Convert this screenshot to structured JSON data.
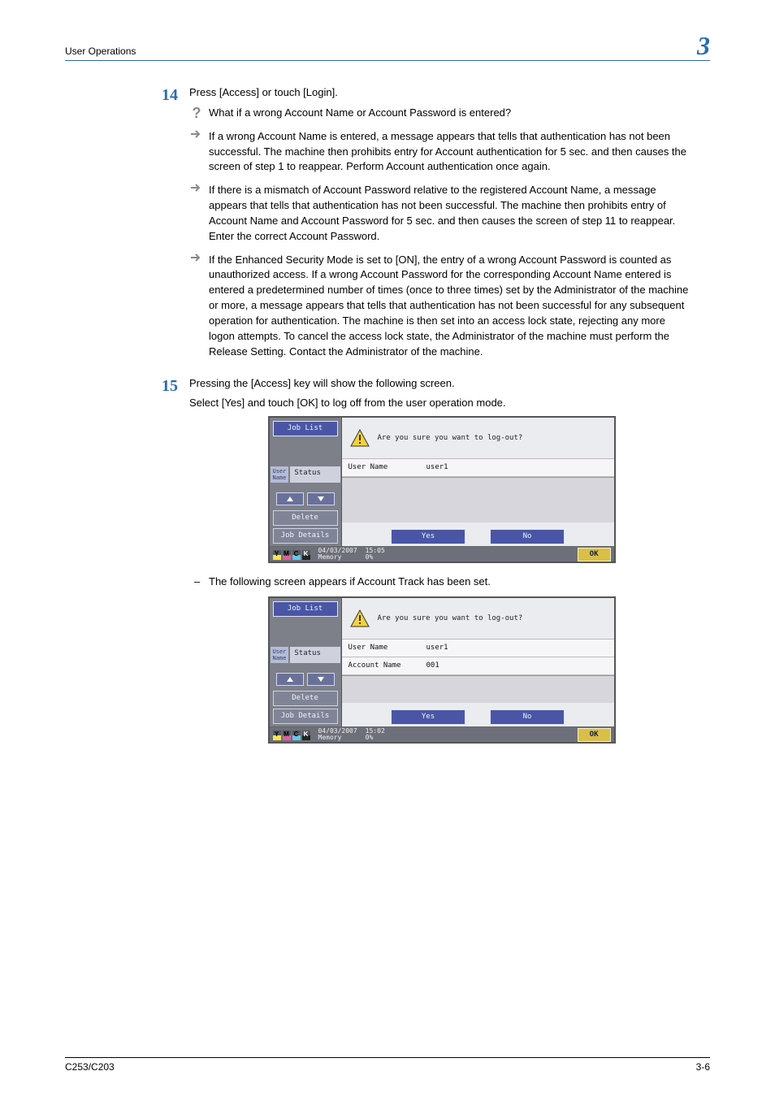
{
  "header": {
    "section_title": "User Operations",
    "chapter_number": "3"
  },
  "steps": {
    "s14": {
      "number": "14",
      "main": "Press [Access] or touch [Login].",
      "question": "What if a wrong Account Name or Account Password is entered?",
      "bullets": [
        "If a wrong Account Name is entered, a message appears that tells that authentication has not been successful. The machine then prohibits entry for Account authentication for 5 sec. and then causes the screen of step 1 to reappear. Perform Account authentication once again.",
        "If there is a mismatch of Account Password relative to the registered Account Name, a message appears that tells that authentication has not been successful. The machine then prohibits entry of Account Name and Account Password for 5 sec. and then causes the screen of step 11 to reappear. Enter the correct Account Password.",
        "If the Enhanced Security Mode is set to [ON], the entry of a wrong Account Password is counted as unauthorized access. If a wrong Account Password for the corresponding Account Name entered is entered a predetermined number of times (once to three times) set by the Administrator of the machine or more, a message appears that tells that authentication has not been successful for any subsequent operation for authentication. The machine is then set into an access lock state, rejecting any more logon attempts. To cancel the access lock state, the Administrator of the machine must perform the Release Setting. Contact the Administrator of the machine."
      ]
    },
    "s15": {
      "number": "15",
      "line1": "Pressing the [Access] key will show the following screen.",
      "line2": "Select [Yes] and touch [OK] to log off from the user operation mode.",
      "dash_note": "The following screen appears if Account Track has been set."
    }
  },
  "screen_common": {
    "job_list": "Job List",
    "user_name_small": "User\nName",
    "status": "Status",
    "delete": "Delete",
    "job_details": "Job Details",
    "prompt": "Are you sure you want to log-out?",
    "field_user_label": "User Name",
    "field_account_label": "Account Name",
    "yes": "Yes",
    "no": "No",
    "ok": "OK",
    "memory_label": "Memory",
    "memory_value": "0%",
    "toner_y": "Y",
    "toner_m": "M",
    "toner_c": "C",
    "toner_k": "K"
  },
  "screen1": {
    "user_value": "user1",
    "date": "04/03/2007",
    "time": "15:05"
  },
  "screen2": {
    "user_value": "user1",
    "account_value": "001",
    "date": "04/03/2007",
    "time": "15:02"
  },
  "footer": {
    "model": "C253/C203",
    "page": "3-6"
  }
}
